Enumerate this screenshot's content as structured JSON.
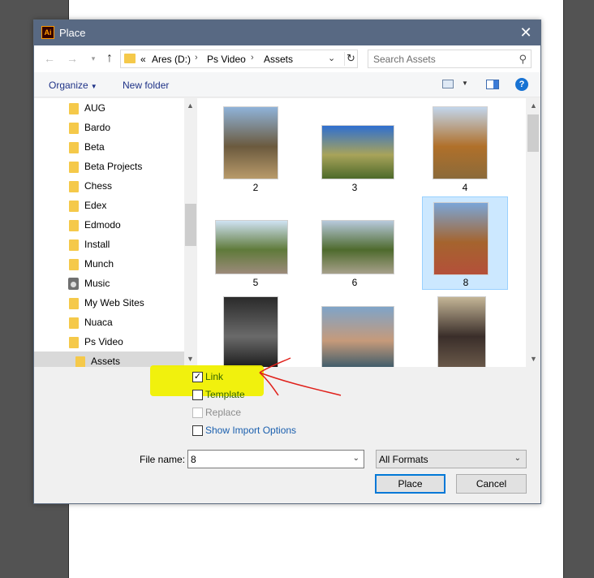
{
  "dialog": {
    "title": "Place",
    "app_icon_text": "Ai",
    "close_glyph": "✕"
  },
  "nav": {
    "back_glyph": "←",
    "forward_glyph": "→",
    "recent_glyph": "▾",
    "up_glyph": "↑",
    "path": {
      "overflow": "«",
      "segments": [
        "Ares (D:)",
        "Ps Video",
        "Assets"
      ],
      "separator": "›"
    },
    "refresh_glyph": "↻",
    "dropdown_glyph": "⌄"
  },
  "search": {
    "placeholder": "Search Assets",
    "icon": "search-icon",
    "glyph": "⚲"
  },
  "toolbar": {
    "organize": "Organize",
    "organize_caret": "▼",
    "new_folder": "New folder",
    "view_caret": "▼",
    "help": "?"
  },
  "tree": {
    "items": [
      {
        "label": "AUG",
        "icon": "folder-icon"
      },
      {
        "label": "Bardo",
        "icon": "folder-icon"
      },
      {
        "label": "Beta",
        "icon": "folder-icon"
      },
      {
        "label": "Beta Projects",
        "icon": "folder-icon"
      },
      {
        "label": "Chess",
        "icon": "folder-icon"
      },
      {
        "label": "Edex",
        "icon": "folder-icon"
      },
      {
        "label": "Edmodo",
        "icon": "folder-icon"
      },
      {
        "label": "Install",
        "icon": "folder-icon"
      },
      {
        "label": "Munch",
        "icon": "folder-icon"
      },
      {
        "label": "Music",
        "icon": "music-icon"
      },
      {
        "label": "My Web Sites",
        "icon": "folder-icon"
      },
      {
        "label": "Nuaca",
        "icon": "folder-icon"
      },
      {
        "label": "Ps Video",
        "icon": "folder-icon"
      },
      {
        "label": "Assets",
        "icon": "folder-icon",
        "selected": true
      }
    ],
    "scroll_up": "▲",
    "scroll_down": "▼"
  },
  "files": {
    "tiles": [
      {
        "label": "2",
        "colors": [
          "#8fb3d9",
          "#6b5a3e",
          "#b89a6a"
        ]
      },
      {
        "label": "3",
        "colors": [
          "#2f6fd0",
          "#a8a35a",
          "#4d6a2a"
        ]
      },
      {
        "label": "4",
        "colors": [
          "#c2d6ec",
          "#b0702a",
          "#8b6a3a"
        ]
      },
      {
        "label": "5",
        "colors": [
          "#cfe2f3",
          "#5f7a3a",
          "#9c8a7a"
        ]
      },
      {
        "label": "6",
        "colors": [
          "#b7c9dc",
          "#4e6a2d",
          "#a7a08a"
        ]
      },
      {
        "label": "8",
        "colors": [
          "#7aa6d8",
          "#a5642e",
          "#b4503a"
        ],
        "selected": true
      },
      {
        "label": "",
        "colors": [
          "#2a2a2a",
          "#6a6a6a",
          "#1a1a1a"
        ]
      },
      {
        "label": "",
        "colors": [
          "#7fa4c8",
          "#c69a7a",
          "#3a5a6a"
        ]
      },
      {
        "label": "",
        "colors": [
          "#c4b596",
          "#3a2e2a",
          "#6b5a4a"
        ]
      }
    ],
    "scroll_up": "▲",
    "scroll_down": "▼"
  },
  "options": {
    "link": {
      "label": "Link",
      "checked": true,
      "check_glyph": "✓"
    },
    "template": {
      "label": "Template",
      "checked": false
    },
    "replace": {
      "label": "Replace",
      "checked": false,
      "disabled": true
    },
    "show_import": {
      "label": "Show Import Options",
      "checked": false
    }
  },
  "filename": {
    "label": "File name:",
    "value": "8",
    "dropdown_glyph": "⌄"
  },
  "format": {
    "value": "All Formats",
    "dropdown_glyph": "⌄"
  },
  "buttons": {
    "place": "Place",
    "cancel": "Cancel"
  },
  "annotation": {
    "highlight_color": "#f0f000",
    "arrow_color": "#e0201a"
  }
}
